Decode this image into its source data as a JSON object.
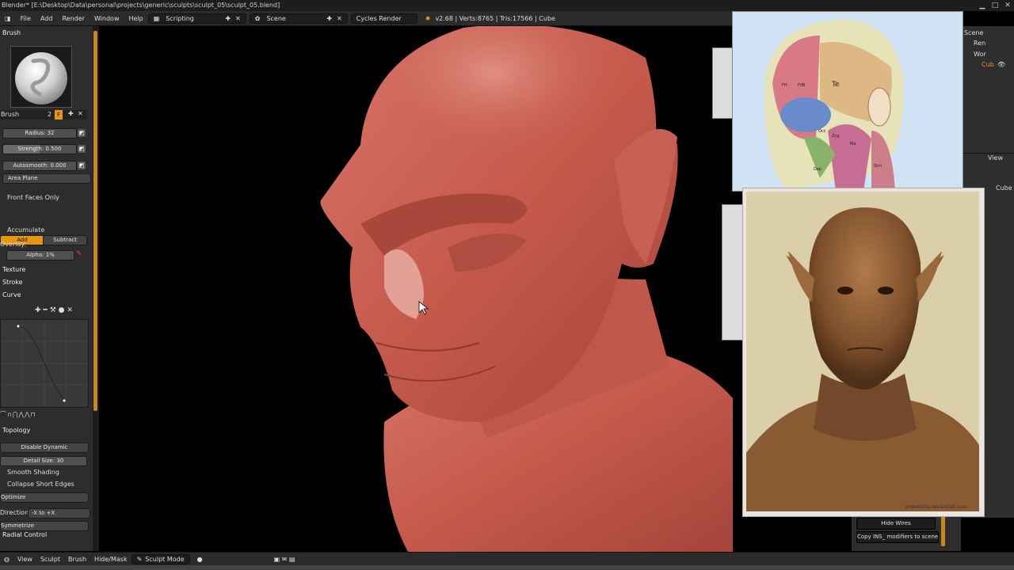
{
  "title_bar": {
    "text": "Blender* [E:\\Desktop\\Data\\personal\\projects\\generic\\sculpts\\sculpt_05\\sculpt_05.blend]"
  },
  "info_header": {
    "menus": [
      "File",
      "Add",
      "Render",
      "Window",
      "Help"
    ],
    "screen_layout": "Scripting",
    "scene": "Scene",
    "render_engine": "Cycles Render",
    "stats": "v2.68 | Verts:8765 | Tris:17566 | Cube"
  },
  "tool_shelf": {
    "brush_header": "Brush",
    "brush_name": "Brush",
    "brush_users": "2",
    "brush_fake_user": "F",
    "radius": "Radius: 32",
    "strength": "Strength: 0.500",
    "autosmooth": "Autosmooth: 0.000",
    "area_plane": "Area Plane",
    "front_faces_only": "Front Faces Only",
    "add_label": "Add",
    "subtract_label": "Subtract",
    "accumulate": "Accumulate",
    "overlay": "Overlay:",
    "alpha": "Alpha: 1%",
    "panels": [
      "Texture",
      "Stroke",
      "Curve"
    ],
    "topology_header": "Topology",
    "disable_dynamic": "Disable Dynamic",
    "detail_size": "Detail Size: 30",
    "smooth_shading": "Smooth Shading",
    "collapse_short_edges": "Collapse Short Edges",
    "optimize": "Optimize",
    "direction_label": "Direction",
    "direction_value": "-X to +X",
    "symmetrize": "Symmetrize",
    "radial_control": "Radial Control"
  },
  "bottom_header": {
    "menus": [
      "View",
      "Sculpt",
      "Brush",
      "Hide/Mask"
    ],
    "mode": "Sculpt Mode"
  },
  "outliner": {
    "items": [
      "Scene",
      "Ren",
      "Wor",
      "Cub"
    ]
  },
  "properties": {
    "view_label": "View",
    "object_name": "Cube",
    "hide_wires_label": "Hide Wires",
    "copy_modifiers_label": "Copy INS_ modifiers to scene"
  },
  "reference_images": {
    "anatomy_labels": [
      "Te",
      "FH",
      "FrBl",
      "Occ",
      "Zyg",
      "Ma",
      "Stm",
      "Dep"
    ],
    "watermark": "artwatkins.deviantart.com"
  },
  "colors": {
    "accent": "#e8950f",
    "sculpt_skin": "#c95a4e",
    "panel_bg": "#2d2d2d"
  }
}
